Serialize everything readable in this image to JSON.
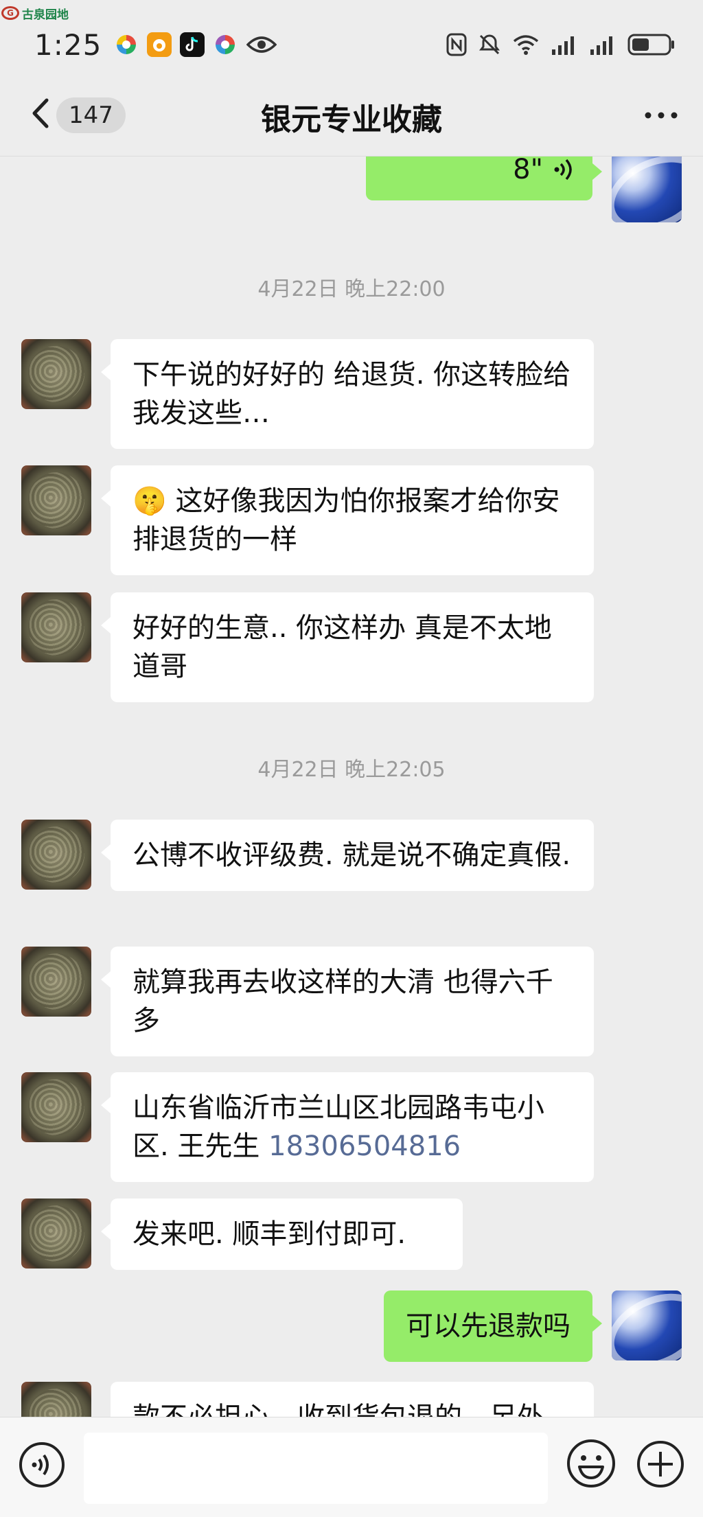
{
  "watermark": {
    "text": "古泉园地"
  },
  "status_bar": {
    "time": "1:25",
    "notification_icons": [
      "browser-app-icon",
      "weibo-app-icon",
      "tiktok-app-icon",
      "browser-app-icon",
      "eye-icon"
    ],
    "system_icons": [
      "nfc-icon",
      "do-not-disturb-icon",
      "wifi-icon",
      "signal-icon",
      "signal-icon",
      "battery-icon"
    ]
  },
  "nav": {
    "back_icon": "chevron-left-icon",
    "unread_count": "147",
    "title": "银元专业收藏",
    "more_icon": "more-dots-icon"
  },
  "messages": [
    {
      "type": "voice",
      "side": "out",
      "duration": "8\""
    },
    {
      "type": "time",
      "text": "4月22日 晚上22:00"
    },
    {
      "type": "text",
      "side": "in",
      "text": " 下午说的好好的 给退货. 你这转脸给我发这些…"
    },
    {
      "type": "text",
      "side": "in",
      "emoji": "🤫",
      "text": " 这好像我因为怕你报案才给你安排退货的一样"
    },
    {
      "type": "text",
      "side": "in",
      "text": "好好的生意.. 你这样办 真是不太地道哥"
    },
    {
      "type": "time",
      "text": "4月22日 晚上22:05"
    },
    {
      "type": "text",
      "side": "in",
      "text": "公博不收评级费. 就是说不确定真假."
    },
    {
      "type": "text",
      "side": "in",
      "text": "就算我再去收这样的大清 也得六千多"
    },
    {
      "type": "text",
      "side": "in",
      "text": "山东省临沂市兰山区北园路韦屯小区.  王先生 ",
      "phone": "18306504816"
    },
    {
      "type": "text",
      "side": "in",
      "text": "发来吧.  顺丰到付即可."
    },
    {
      "type": "text",
      "side": "out",
      "text": "可以先退款吗"
    },
    {
      "type": "text",
      "side": "in",
      "text": "款不必担心，收到货包退的，另外"
    }
  ],
  "input_bar": {
    "voice_icon": "voice-input-icon",
    "emoji_icon": "emoji-icon",
    "plus_icon": "plus-icon"
  }
}
